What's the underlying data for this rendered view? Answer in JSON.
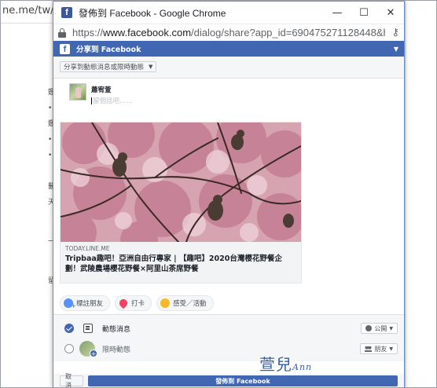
{
  "background_page": {
    "url_fragment": "ne.me/tw/pc/ar",
    "text_fragments": [
      "鑑",
      "•",
      "鑑",
      "•",
      "•",
      "醫",
      "天",
      "一",
      "留"
    ]
  },
  "window": {
    "title": "發佈到 Facebook - Google Chrome",
    "favicon_letter": "f",
    "controls": {
      "minimize": "—",
      "maximize": "☐",
      "close": "✕"
    }
  },
  "address_bar": {
    "scheme": "https://",
    "host": "www.facebook.com",
    "path": "/dialog/share?app_id=690475271128448&h..."
  },
  "fb_dialog": {
    "header_title": "分享到 Facebook",
    "logo_letter": "f",
    "share_dropdown": "分享到動態消息或限時動態",
    "user_name": "蕭宥萱",
    "compose_placeholder": "留個話吧……",
    "link_preview": {
      "domain": "TODAY.LINE.ME",
      "title": "Tripbaa趣吧！亞洲自由行專家 | 【趣吧】2020台灣櫻花野餐企劃！武陵農場櫻花野餐×阿里山茶席野餐"
    },
    "actions": {
      "tag_friends": "標註朋友",
      "check_in": "打卡",
      "feeling": "感受／活動"
    },
    "targets": {
      "newsfeed_label": "動態消息",
      "newsfeed_audience": "公開",
      "story_label": "限時動態",
      "story_audience": "朋友"
    },
    "watermark": {
      "chinese": "萱兒",
      "signature": "Ann"
    },
    "footer": {
      "cancel": "取消",
      "post": "發佈到 Facebook"
    }
  },
  "colors": {
    "facebook_blue": "#4267b2",
    "window_border": "#6b8fbf"
  }
}
